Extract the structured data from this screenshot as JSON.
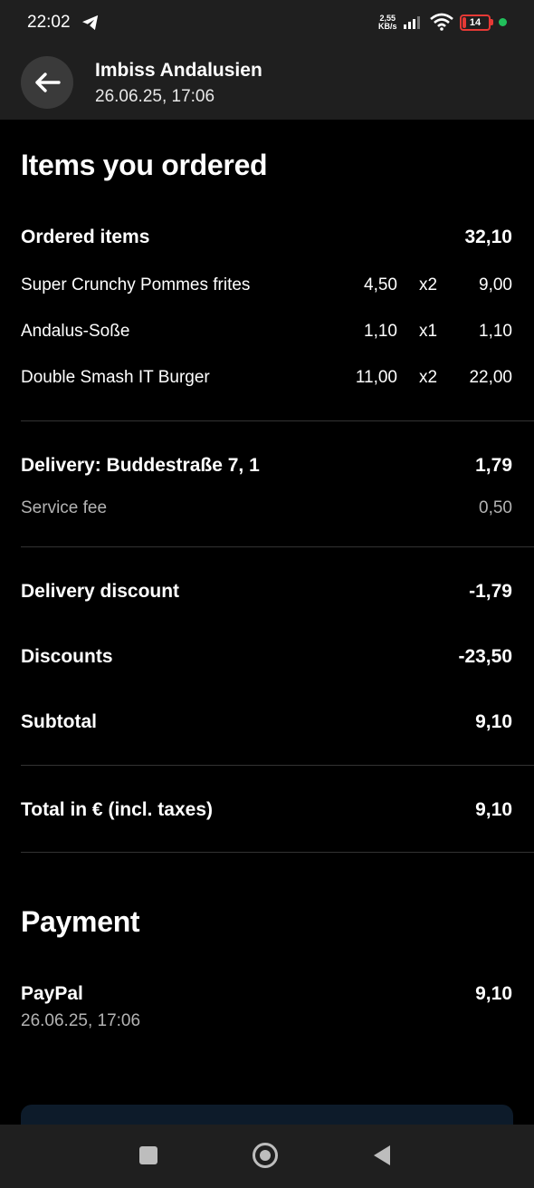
{
  "status_bar": {
    "time": "22:02",
    "net_speed_value": "2,55",
    "net_speed_unit": "KB/s",
    "battery": "14",
    "battery_level_percent": 14,
    "icons": [
      "telegram-icon",
      "signal-icon",
      "wifi-icon",
      "battery-icon"
    ]
  },
  "header": {
    "title": "Imbiss Andalusien",
    "subtitle": "26.06.25, 17:06"
  },
  "order": {
    "section_title": "Items you ordered",
    "ordered_items_label": "Ordered items",
    "ordered_items_total": "32,10",
    "items": [
      {
        "name": "Super Crunchy Pommes frites",
        "price": "4,50",
        "qty": "x2",
        "total": "9,00"
      },
      {
        "name": "Andalus-Soße",
        "price": "1,10",
        "qty": "x1",
        "total": "1,10"
      },
      {
        "name": "Double Smash IT Burger",
        "price": "11,00",
        "qty": "x2",
        "total": "22,00"
      }
    ],
    "delivery_label": "Delivery: Buddestraße 7, 1",
    "delivery_value": "1,79",
    "service_fee_label": "Service fee",
    "service_fee_value": "0,50",
    "delivery_discount_label": "Delivery discount",
    "delivery_discount_value": "-1,79",
    "discounts_label": "Discounts",
    "discounts_value": "-23,50",
    "subtotal_label": "Subtotal",
    "subtotal_value": "9,10",
    "total_label": "Total in € (incl. taxes)",
    "total_value": "9,10"
  },
  "payment": {
    "section_title": "Payment",
    "method": "PayPal",
    "date": "26.06.25, 17:06",
    "amount": "9,10"
  },
  "colors": {
    "background": "#000000",
    "bar_background": "#1f1f1f",
    "muted_text": "#b3b3b3",
    "battery_low": "#e53935",
    "status_dot": "#21c05b"
  },
  "nav": {
    "icons": [
      "recent-apps-icon",
      "home-icon",
      "back-triangle-icon"
    ]
  }
}
